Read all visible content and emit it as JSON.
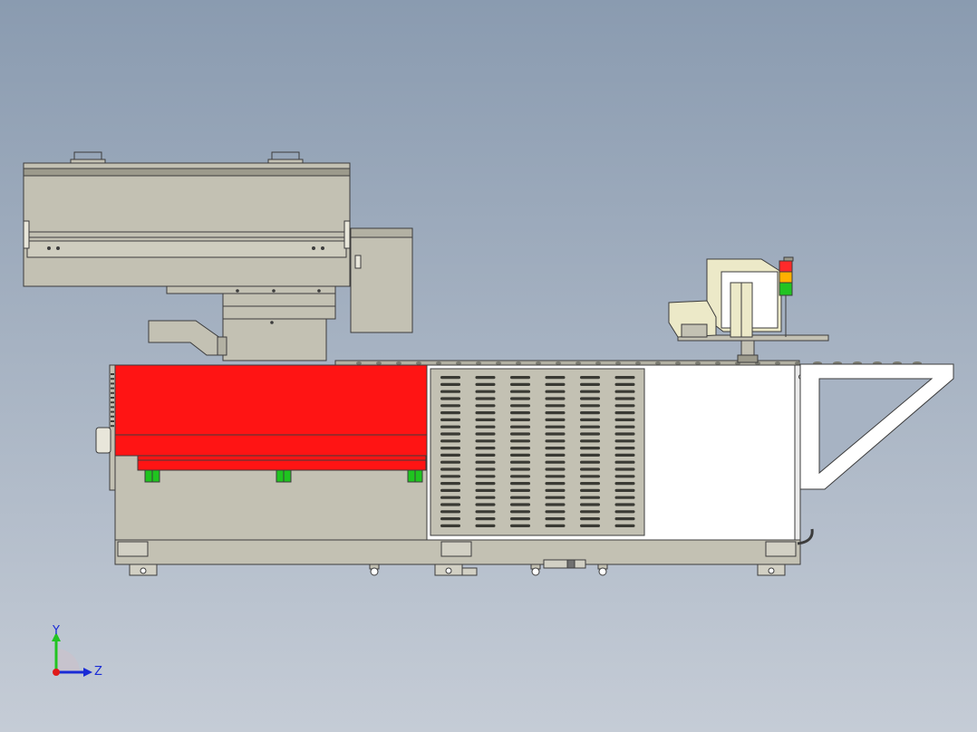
{
  "view": {
    "background_top": "#8a9bb0",
    "background_bottom": "#c5ccd6"
  },
  "colors": {
    "panel_gray": "#c3c1b3",
    "panel_dark": "#9c9a8c",
    "red_cover": "#ff1414",
    "white_panel": "#ffffff",
    "vent_slot": "#3a3a34",
    "green_clamp": "#1fc41f",
    "monitor_beige": "#ece9c8",
    "outline": "#3c3c3c"
  },
  "signal_tower": [
    "#ff2a2a",
    "#ffb000",
    "#22c422"
  ],
  "triad": {
    "y_label": "Y",
    "z_label": "Z"
  },
  "vent_grid": {
    "columns": 6,
    "rows": 22
  },
  "icons": {
    "triad": "coordinate-triad-icon",
    "signal_tower": "signal-tower-icon",
    "monitor": "monitor-icon"
  }
}
